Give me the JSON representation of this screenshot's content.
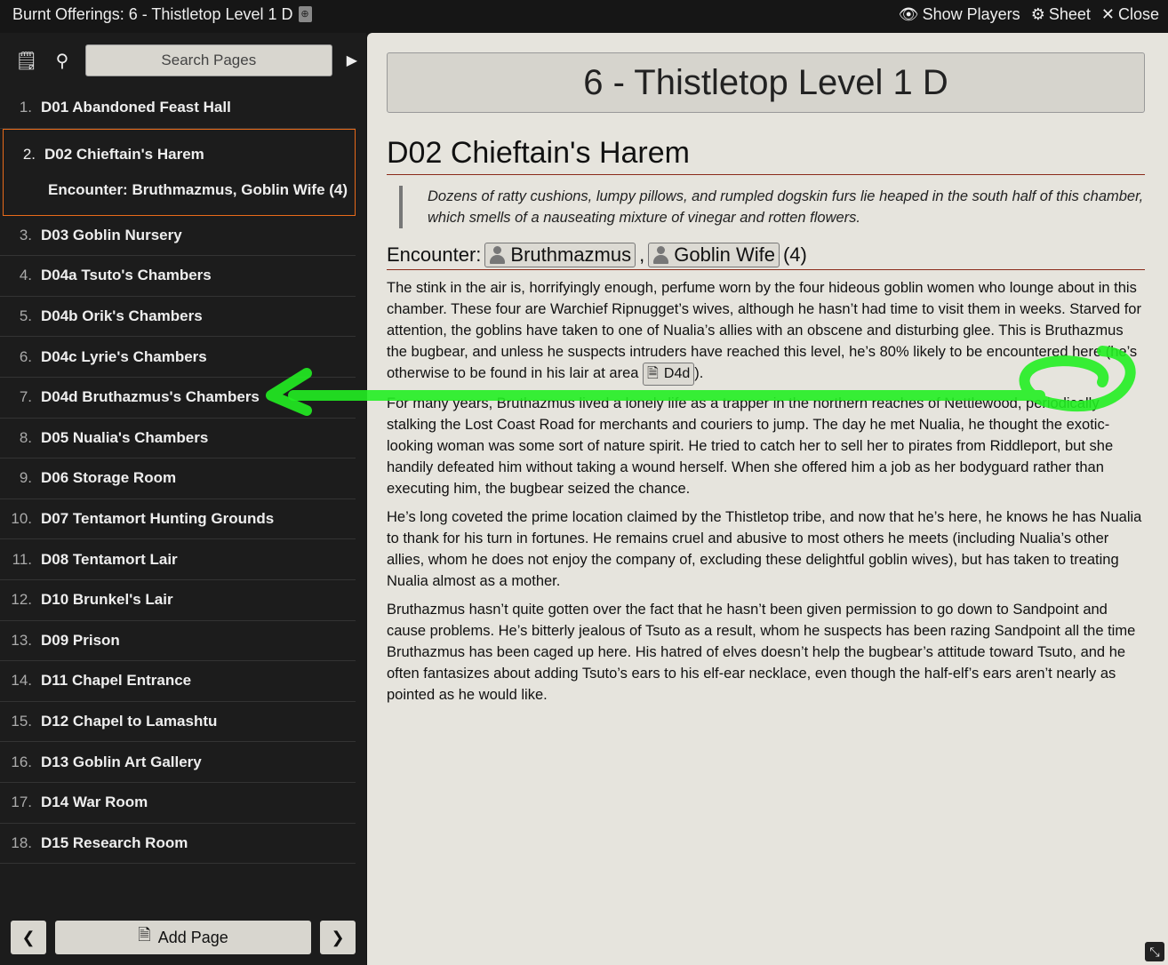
{
  "header": {
    "title": "Burnt Offerings: 6 - Thistletop Level 1 D",
    "show_players": "Show Players",
    "sheet": "Sheet",
    "close": "Close"
  },
  "sidebar": {
    "search_placeholder": "Search Pages",
    "items": [
      {
        "n": "1.",
        "label": "D01 Abandoned Feast Hall"
      },
      {
        "n": "2.",
        "label": "D02 Chieftain's Harem",
        "sub": "Encounter: Bruthmazmus, Goblin Wife (4)",
        "active": true
      },
      {
        "n": "3.",
        "label": "D03 Goblin Nursery"
      },
      {
        "n": "4.",
        "label": "D04a Tsuto's Chambers"
      },
      {
        "n": "5.",
        "label": "D04b Orik's Chambers"
      },
      {
        "n": "6.",
        "label": "D04c Lyrie's Chambers"
      },
      {
        "n": "7.",
        "label": "D04d Bruthazmus's Chambers"
      },
      {
        "n": "8.",
        "label": "D05 Nualia's Chambers"
      },
      {
        "n": "9.",
        "label": "D06 Storage Room"
      },
      {
        "n": "10.",
        "label": "D07 Tentamort Hunting Grounds"
      },
      {
        "n": "11.",
        "label": "D08 Tentamort Lair"
      },
      {
        "n": "12.",
        "label": "D10 Brunkel's Lair"
      },
      {
        "n": "13.",
        "label": "D09 Prison"
      },
      {
        "n": "14.",
        "label": "D11 Chapel Entrance"
      },
      {
        "n": "15.",
        "label": "D12 Chapel to Lamashtu"
      },
      {
        "n": "16.",
        "label": "D13 Goblin Art Gallery"
      },
      {
        "n": "17.",
        "label": "D14 War Room"
      },
      {
        "n": "18.",
        "label": "D15 Research Room"
      }
    ],
    "add_page": "Add Page"
  },
  "main": {
    "banner": "6 - Thistletop Level 1 D",
    "heading": "D02 Chieftain's Harem",
    "quote": "Dozens of ratty cushions, lumpy pillows, and rumpled dogskin furs lie heaped in the south half of this chamber, which smells of a nauseating mixture of vinegar and rotten flowers.",
    "encounter_label": "Encounter:",
    "encounter_a": "Bruthmazmus",
    "comma": ",",
    "encounter_b": "Goblin Wife",
    "encounter_count": "(4)",
    "p1": "The stink in the air is, horrifyingly enough, perfume worn by the four hideous goblin women who lounge about in this chamber. These four are Warchief Ripnugget’s wives, although he hasn’t had time to visit them in weeks. Starved for attention, the goblins have taken to one of Nualia’s allies with an obscene and disturbing glee. This is Bruthazmus the bugbear, and unless he suspects intruders have reached this level, he’s 80% likely to be encountered here (he’s otherwise to be found in his lair at area",
    "p1_link": "D4d",
    "p1_end": ").",
    "p2": "For many years, Bruthazmus lived a lonely life as a trapper in the northern reaches of Nettlewood, periodically stalking the Lost Coast Road for merchants and couriers to jump. The day he met Nualia, he thought the exotic-looking woman was some sort of nature spirit. He tried to catch her to sell her to pirates from Riddleport, but she handily defeated him without taking a wound herself. When she offered him a job as her bodyguard rather than executing him, the bugbear seized the chance.",
    "p3": "He’s long coveted the prime location claimed by the Thistletop tribe, and now that he’s here, he knows he has Nualia to thank for his turn in fortunes. He remains cruel and abusive to most others he meets (including Nualia’s other allies, whom he does not enjoy the company of, excluding these delightful goblin wives), but has taken to treating Nualia almost as a mother.",
    "p4": "Bruthazmus hasn’t quite gotten over the fact that he hasn’t been given permission to go down to Sandpoint and cause problems. He’s bitterly jealous of Tsuto as a result, whom he suspects has been razing Sandpoint all the time Bruthazmus has been caged up here. His hatred of elves doesn’t help the bugbear’s attitude toward Tsuto, and he often fantasizes about adding Tsuto’s ears to his elf-ear necklace, even though the half-elf’s ears aren’t nearly as pointed as he would like."
  },
  "colors": {
    "active_border": "#e86a1a",
    "annotation": "#22ee22",
    "heading_rule": "#8b2a1a"
  }
}
